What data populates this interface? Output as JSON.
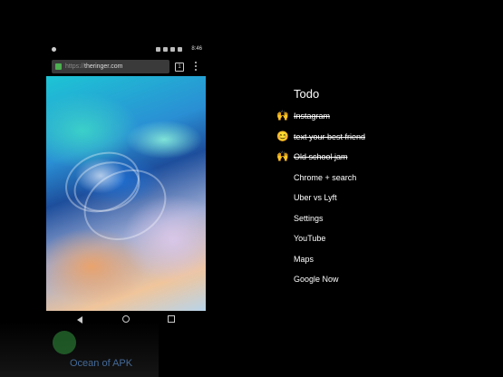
{
  "browser": {
    "url_scheme": "https://",
    "url_host": "theringer.com",
    "tab_count": "1",
    "time": "8:46"
  },
  "todo": {
    "title": "Todo",
    "items": [
      {
        "label": "Instagram",
        "done": true,
        "emoji": "🙌"
      },
      {
        "label": "text your best friend",
        "done": true,
        "emoji": "😊"
      },
      {
        "label": "Old school jam",
        "done": true,
        "emoji": "🙌"
      },
      {
        "label": "Chrome + search",
        "done": false,
        "emoji": ""
      },
      {
        "label": "Uber vs Lyft",
        "done": false,
        "emoji": ""
      },
      {
        "label": "Settings",
        "done": false,
        "emoji": ""
      },
      {
        "label": "YouTube",
        "done": false,
        "emoji": ""
      },
      {
        "label": "Maps",
        "done": false,
        "emoji": ""
      },
      {
        "label": "Google Now",
        "done": false,
        "emoji": ""
      }
    ]
  },
  "watermark": {
    "text": "Ocean of APK"
  },
  "colors": {
    "background": "#000000",
    "url_bar": "#3a3a3a",
    "secure_lock": "#4caf50"
  }
}
